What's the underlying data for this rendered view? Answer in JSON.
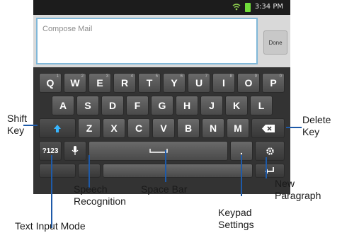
{
  "status": {
    "time": "3:34 PM"
  },
  "compose": {
    "placeholder": "Compose Mail",
    "done_label": "Done"
  },
  "keys": {
    "row1": [
      {
        "label": "Q",
        "alt": "1"
      },
      {
        "label": "W",
        "alt": "2"
      },
      {
        "label": "E",
        "alt": "3"
      },
      {
        "label": "R",
        "alt": "4"
      },
      {
        "label": "T",
        "alt": "5"
      },
      {
        "label": "Y",
        "alt": "6"
      },
      {
        "label": "U",
        "alt": "7"
      },
      {
        "label": "I",
        "alt": "8"
      },
      {
        "label": "O",
        "alt": "9"
      },
      {
        "label": "P",
        "alt": "0"
      }
    ],
    "row2": [
      "A",
      "S",
      "D",
      "F",
      "G",
      "H",
      "J",
      "K",
      "L"
    ],
    "row3": [
      "Z",
      "X",
      "C",
      "V",
      "B",
      "N",
      "M"
    ],
    "mode_label": "?123",
    "period_label": "."
  },
  "callouts": {
    "shift": [
      "Shift",
      "Key"
    ],
    "delete": [
      "Delete",
      "Key"
    ],
    "speech": [
      "Speech",
      "Recognition"
    ],
    "space": "Space Bar",
    "new_paragraph": [
      "New",
      "Paragraph"
    ],
    "keypad": [
      "Keypad",
      "Settings"
    ],
    "text_mode": "Text Input Mode"
  }
}
